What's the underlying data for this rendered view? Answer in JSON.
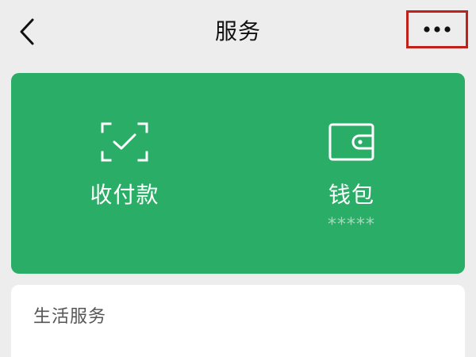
{
  "header": {
    "title": "服务",
    "back_icon": "chevron-left-icon",
    "more_icon": "more-horizontal-icon",
    "more_highlight_color": "#c0211b"
  },
  "card": {
    "background_color": "#2aae67",
    "actions": [
      {
        "label": "收付款",
        "icon": "scan-pay-icon"
      },
      {
        "label": "钱包",
        "icon": "wallet-icon",
        "balance_masked": "*****"
      }
    ]
  },
  "life_services": {
    "title": "生活服务"
  }
}
